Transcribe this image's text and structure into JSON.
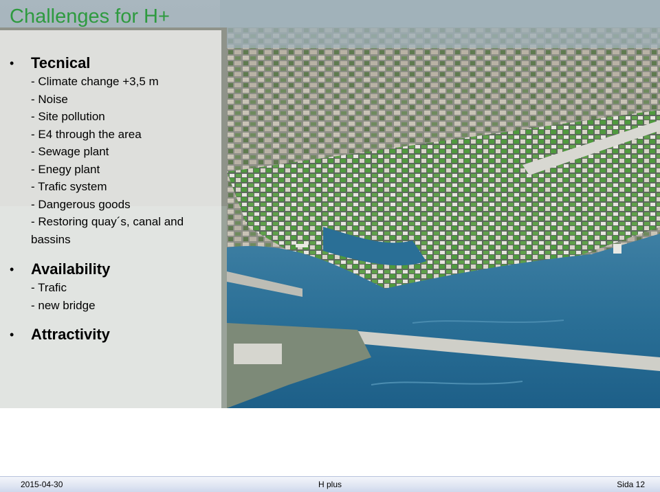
{
  "slide": {
    "title": "Challenges for H+"
  },
  "sections": [
    {
      "heading": "Tecnical",
      "items": [
        "- Climate change +3,5 m",
        "- Noise",
        "- Site pollution",
        "- E4 through the area",
        "- Sewage plant",
        "- Enegy plant",
        "- Trafic system",
        "- Dangerous goods",
        "- Restoring quay´s, canal and bassins"
      ]
    },
    {
      "heading": "Availability",
      "items": [
        "- Trafic",
        "- new bridge"
      ]
    },
    {
      "heading": "Attractivity",
      "items": []
    }
  ],
  "bullet_glyph": "•",
  "footer": {
    "date": "2015-04-30",
    "center": "H plus",
    "page": "Sida 12"
  },
  "colors": {
    "title": "#2e9a3f",
    "water": "#1f6f96",
    "footer_band": "#dfe5f2"
  }
}
